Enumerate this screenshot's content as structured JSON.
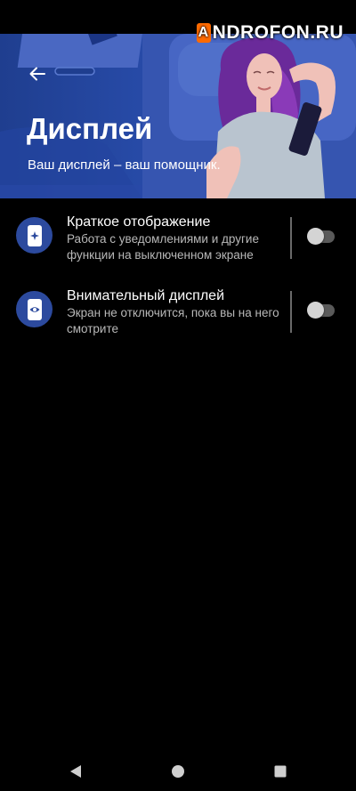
{
  "watermark": {
    "logo_glyph": "A",
    "text": "NDROFON.RU"
  },
  "header": {
    "title": "Дисплей",
    "subtitle": "Ваш дисплей – ваш помощник.",
    "accent_color": "#2a4fb0"
  },
  "settings": [
    {
      "title": "Краткое отображение",
      "description": "Работа с уведомлениями и другие функции на выключенном экране",
      "icon": "phone-sparkle-icon",
      "enabled": false
    },
    {
      "title": "Внимательный дисплей",
      "description": "Экран не отключится, пока вы на него смотрите",
      "icon": "phone-eye-icon",
      "enabled": false
    }
  ],
  "navigation": {
    "buttons": [
      "back-triangle-icon",
      "home-circle-icon",
      "recents-square-icon"
    ]
  }
}
